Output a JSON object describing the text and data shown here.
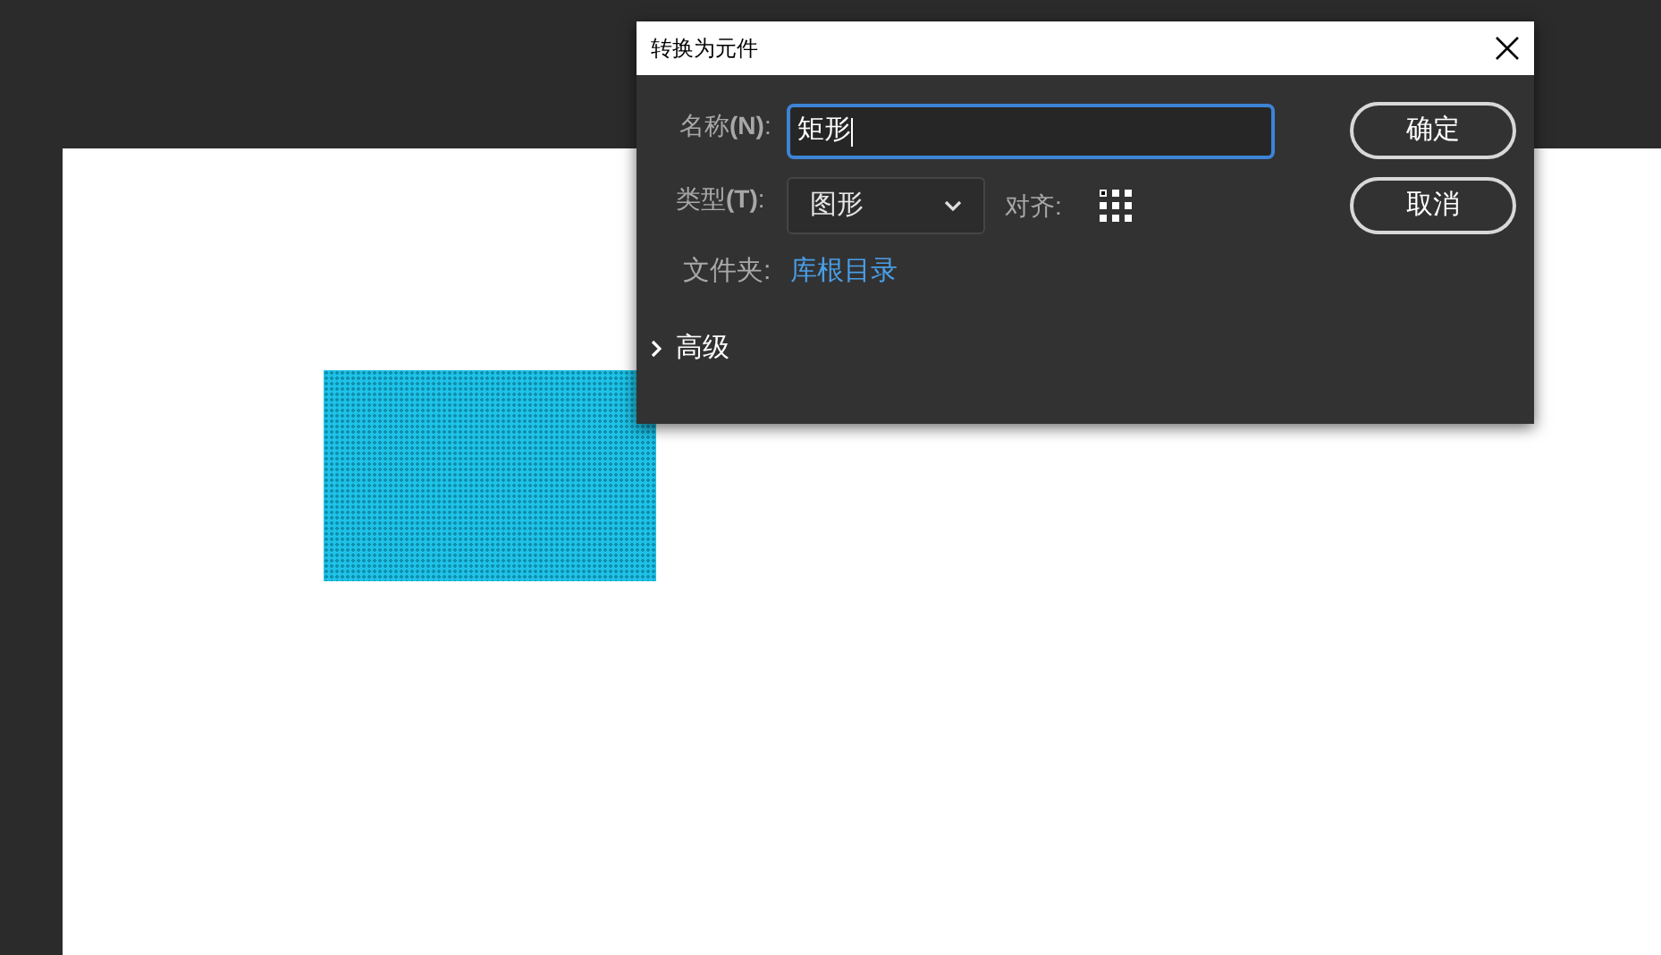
{
  "stage": {
    "shape": {
      "kind": "rectangle",
      "selected": true
    }
  },
  "dialog": {
    "title": "转换为元件",
    "name_label": "名称**(N)**:",
    "name_value": "矩形",
    "type_label": "类型**(T)**:",
    "type_value": "图形",
    "align_label": "对齐:",
    "registration": [
      {
        "selected": true
      },
      {
        "selected": false
      },
      {
        "selected": false
      },
      {
        "selected": false
      },
      {
        "selected": false
      },
      {
        "selected": false
      },
      {
        "selected": false
      },
      {
        "selected": false
      },
      {
        "selected": false
      }
    ],
    "folder_label": "文件夹:",
    "folder_link": "库根目录",
    "advanced": {
      "label": "高级",
      "expanded": false
    },
    "buttons": [
      "确定",
      "取消"
    ]
  }
}
